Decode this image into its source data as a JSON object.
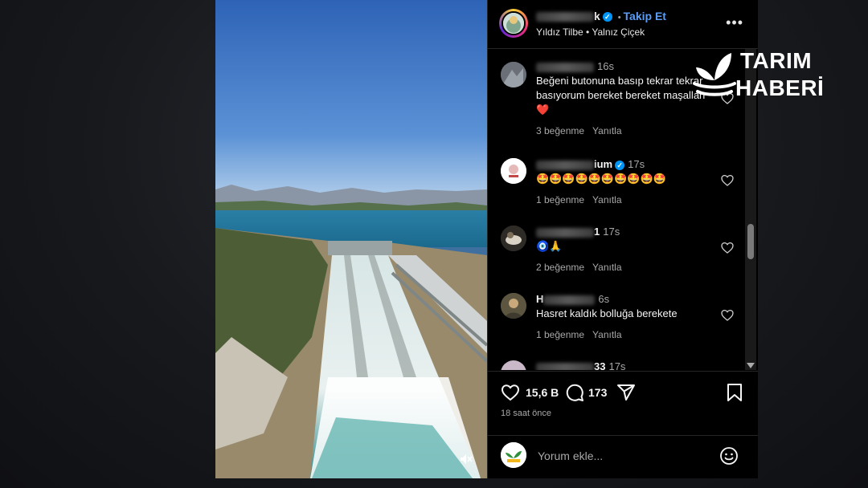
{
  "post": {
    "header": {
      "username_tail": "k",
      "separator": "•",
      "follow_label": "Takip Et",
      "audio_artist": "Yıldız Tilbe",
      "audio_separator": "•",
      "audio_title": "Yalnız Çiçek",
      "more_label": "•••"
    },
    "comments": [
      {
        "username_tail": "",
        "time": "16s",
        "text": "Beğeni butonuna basıp tekrar tekrar basıyorum bereket bereket maşallah",
        "emoji": "❤️",
        "likes": "3 beğenme",
        "reply": "Yanıtla"
      },
      {
        "username_tail": "ium",
        "time": "17s",
        "text": "🤩🤩🤩🤩🤩🤩🤩🤩🤩🤩",
        "likes": "1 beğenme",
        "reply": "Yanıtla"
      },
      {
        "username_tail": "1",
        "time": "17s",
        "text": "🧿🙏",
        "likes": "2 beğenme",
        "reply": "Yanıtla"
      },
      {
        "username_head": "H",
        "time": "6s",
        "text": "Hasret kaldık bolluğa berekete",
        "likes": "1 beğenme",
        "reply": "Yanıtla"
      },
      {
        "username_tail": "33",
        "time": "17s"
      }
    ],
    "actions": {
      "likes": "15,6 B",
      "comments": "173",
      "time_ago": "18 saat önce"
    },
    "add_comment": {
      "placeholder": "Yorum ekle..."
    }
  },
  "logo": {
    "line1": "TARIM",
    "line2": "HABERİ"
  },
  "colors": {
    "background": "#14161a",
    "panel": "#000000",
    "accent_link": "#5b9df5",
    "verified": "#0095f6",
    "heart_emoji": "#ff3040"
  },
  "icons": [
    "heart-icon",
    "comment-icon",
    "share-icon",
    "bookmark-icon",
    "emoji-icon",
    "mute-icon",
    "verified-icon"
  ]
}
